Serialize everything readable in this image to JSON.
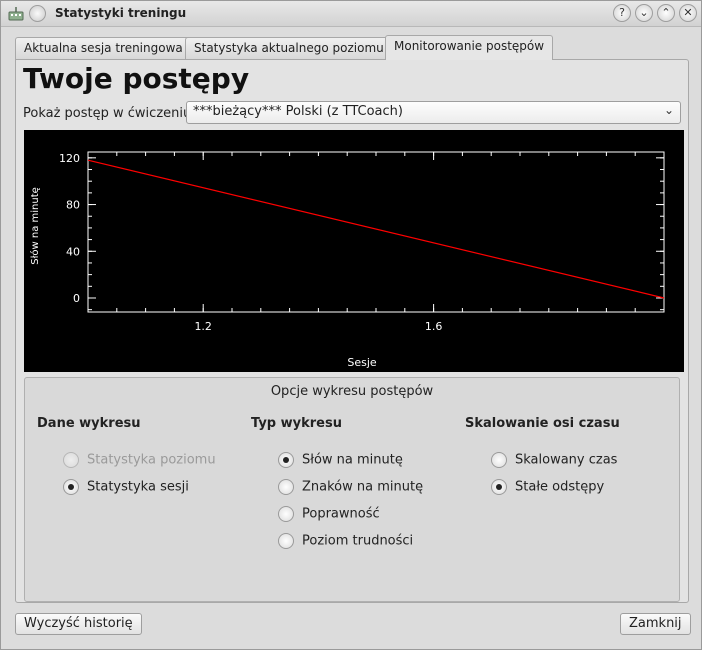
{
  "window": {
    "title": "Statystyki treningu"
  },
  "tabs": [
    {
      "label": "Aktualna sesja treningowa"
    },
    {
      "label": "Statystyka aktualnego poziomu"
    },
    {
      "label": "Monitorowanie postępów"
    }
  ],
  "main": {
    "heading": "Twoje postępy",
    "exercise_label": "Pokaż postęp w ćwiczeniu:",
    "exercise_value": "***bieżący***  Polski (z TTCoach)"
  },
  "chart_data": {
    "type": "line",
    "xlabel": "Sesje",
    "ylabel": "Słów na minutę",
    "xlim": [
      1.0,
      2.0
    ],
    "ylim": [
      -12,
      125
    ],
    "x_ticks": [
      1.2,
      1.6
    ],
    "y_ticks": [
      0,
      40,
      80,
      120
    ],
    "series": [
      {
        "x": [
          1.0,
          2.0
        ],
        "y": [
          118,
          0
        ],
        "color": "#ff0000"
      }
    ],
    "background": "#000000",
    "foreground": "#ffffff"
  },
  "options": {
    "title": "Opcje wykresu postępów",
    "data_group": {
      "heading": "Dane wykresu",
      "items": [
        {
          "label": "Statystyka poziomu",
          "checked": false,
          "disabled": true
        },
        {
          "label": "Statystyka sesji",
          "checked": true,
          "disabled": false
        }
      ]
    },
    "type_group": {
      "heading": "Typ wykresu",
      "items": [
        {
          "label": "Słów na minutę",
          "checked": true
        },
        {
          "label": "Znaków na minutę",
          "checked": false
        },
        {
          "label": "Poprawność",
          "checked": false
        },
        {
          "label": "Poziom trudności",
          "checked": false
        }
      ]
    },
    "scale_group": {
      "heading": "Skalowanie osi czasu",
      "items": [
        {
          "label": "Skalowany czas",
          "checked": false
        },
        {
          "label": "Stałe odstępy",
          "checked": true
        }
      ]
    }
  },
  "footer": {
    "clear_label": "Wyczyść historię",
    "close_label": "Zamknij"
  }
}
